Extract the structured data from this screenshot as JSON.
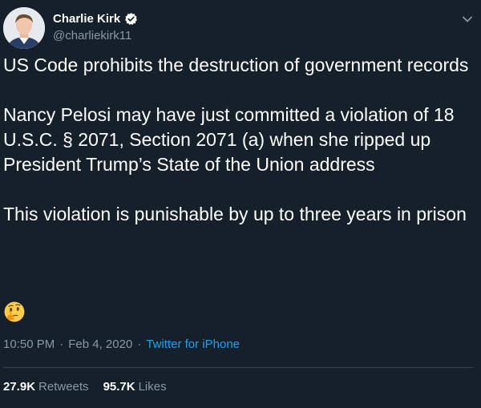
{
  "author": {
    "display_name": "Charlie Kirk",
    "handle": "@charliekirk11",
    "verified": true
  },
  "tweet": {
    "paragraphs": [
      "US Code prohibits the destruction of government records",
      "Nancy Pelosi may have just committed a violation of 18 U.S.C. § 2071, Section 2071 (a) when she ripped up President Trump’s State of the Union address",
      "This violation is punishable by up to three years in prison"
    ],
    "emoji": "thinking-face-emoji"
  },
  "meta": {
    "time": "10:50 PM",
    "separator": "·",
    "date": "Feb 4, 2020",
    "source": "Twitter for iPhone"
  },
  "stats": {
    "retweets_count": "27.9K",
    "retweets_label": "Retweets",
    "likes_count": "95.7K",
    "likes_label": "Likes"
  },
  "colors": {
    "background": "#15202b",
    "text": "#ffffff",
    "secondary_text": "#8899a6",
    "link": "#1da1f2",
    "divider": "#38444d"
  },
  "icons": {
    "verified": "verified-badge-icon",
    "menu": "chevron-down-icon"
  }
}
